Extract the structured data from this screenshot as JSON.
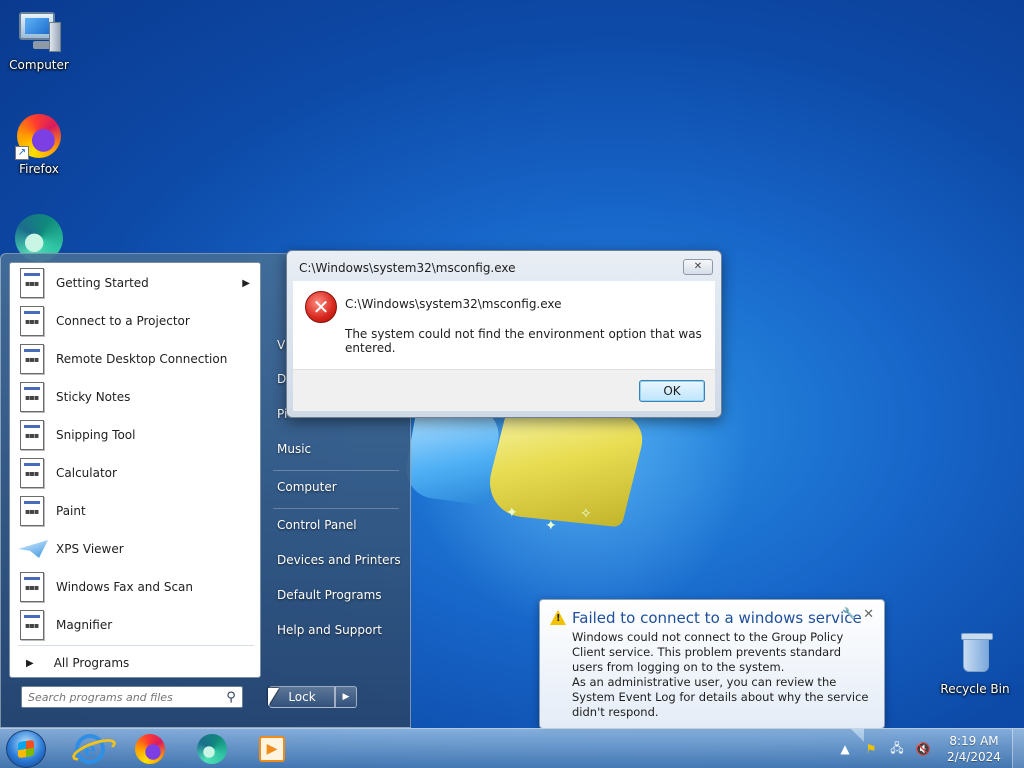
{
  "desktop": {
    "icons": [
      {
        "label": "Computer",
        "icon": "computer-icon"
      },
      {
        "label": "Firefox",
        "icon": "firefox-icon"
      },
      {
        "label": "",
        "icon": "edge-icon"
      },
      {
        "label": "Recycle Bin",
        "icon": "recycle-bin-icon"
      }
    ]
  },
  "start_menu": {
    "programs": [
      {
        "label": "Getting Started",
        "icon": "app-icon",
        "has_submenu": true
      },
      {
        "label": "Connect to a Projector",
        "icon": "app-icon"
      },
      {
        "label": "Remote Desktop Connection",
        "icon": "app-icon"
      },
      {
        "label": "Sticky Notes",
        "icon": "app-icon"
      },
      {
        "label": "Snipping Tool",
        "icon": "app-icon"
      },
      {
        "label": "Calculator",
        "icon": "app-icon"
      },
      {
        "label": "Paint",
        "icon": "app-icon"
      },
      {
        "label": "XPS Viewer",
        "icon": "xps-icon"
      },
      {
        "label": "Windows Fax and Scan",
        "icon": "app-icon"
      },
      {
        "label": "Magnifier",
        "icon": "app-icon"
      }
    ],
    "all_programs": "All Programs",
    "search_placeholder": "Search programs and files",
    "right_links": [
      "Vi",
      "D",
      "Pi",
      "Music",
      "Computer",
      "Control Panel",
      "Devices and Printers",
      "Default Programs",
      "Help and Support"
    ],
    "lock_label": "Lock"
  },
  "dialog": {
    "title": "C:\\Windows\\system32\\msconfig.exe",
    "path": "C:\\Windows\\system32\\msconfig.exe",
    "message": "The system could not find the environment option that was entered.",
    "ok_label": "OK",
    "close_label": "✕"
  },
  "balloon": {
    "title": "Failed to connect to a windows service",
    "body_line1": "Windows could not connect to the Group Policy Client service. This problem prevents standard users from logging on to the system.",
    "body_line2": "As an administrative user, you can review the System Event Log for details about why the service didn't respond."
  },
  "taskbar": {
    "pinned": [
      "internet-explorer-icon",
      "firefox-icon",
      "edge-icon",
      "media-player-icon"
    ],
    "clock_time": "8:19 AM",
    "clock_date": "2/4/2024"
  }
}
